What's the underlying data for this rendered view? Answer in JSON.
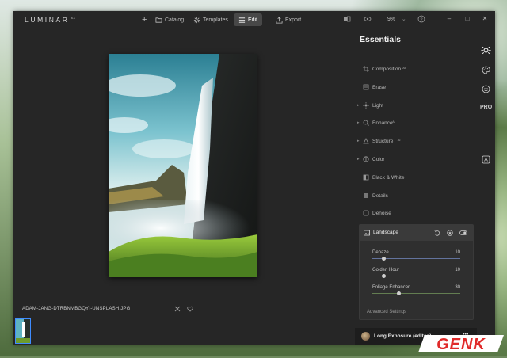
{
  "app": {
    "logo": "LUMINAR",
    "logo_sup": "4.1"
  },
  "topnav": {
    "add_label": "+",
    "catalog": "Catalog",
    "templates": "Templates",
    "edit": "Edit",
    "export": "Export",
    "zoom": "9%",
    "zoom_caret": "⌄"
  },
  "window_controls": {
    "minimize": "–",
    "maximize": "□",
    "close": "✕"
  },
  "panel": {
    "title": "Essentials",
    "tools": [
      {
        "label": "Composition",
        "ai": "AI",
        "icon": "crop-icon",
        "expandable": false
      },
      {
        "label": "Erase",
        "ai": "",
        "icon": "erase-icon",
        "expandable": false
      },
      {
        "label": "Light",
        "ai": "",
        "icon": "sun-icon",
        "expandable": true
      },
      {
        "label": "Enhance",
        "ai": "AI",
        "icon": "enhance-icon",
        "expandable": true
      },
      {
        "label": "Structure",
        "ai": "AI",
        "icon": "structure-icon",
        "expandable": true
      },
      {
        "label": "Color",
        "ai": "",
        "icon": "color-icon",
        "expandable": true
      },
      {
        "label": "Black & White",
        "ai": "",
        "icon": "bw-icon",
        "expandable": false
      },
      {
        "label": "Details",
        "ai": "",
        "icon": "details-icon",
        "expandable": false
      },
      {
        "label": "Denoise",
        "ai": "",
        "icon": "denoise-icon",
        "expandable": false
      }
    ],
    "landscape": {
      "title": "Landscape",
      "sliders": [
        {
          "label": "Dehaze",
          "value": "10",
          "fraction": 0.13,
          "fill_color": "#6f8dd8"
        },
        {
          "label": "Golden Hour",
          "value": "10",
          "fraction": 0.13,
          "fill_color": "#d8a64a"
        },
        {
          "label": "Foliage Enhancer",
          "value": "30",
          "fraction": 0.3,
          "fill_color": "#6f9e4e"
        }
      ],
      "advanced": "Advanced Settings"
    },
    "preset": {
      "label": "Long Exposure (edited)",
      "more": "•••"
    }
  },
  "rail": {
    "pro": "PRO"
  },
  "image": {
    "filename": "ADAM-JANG-DTRBNMBGQYI-UNSPLASH.JPG"
  },
  "watermark": {
    "text": "GENK"
  },
  "colors": {
    "accent": "#3f8cff",
    "bg": "#262626",
    "panel_active": "#3a3a3a",
    "watermark_red": "#e02a2a"
  }
}
